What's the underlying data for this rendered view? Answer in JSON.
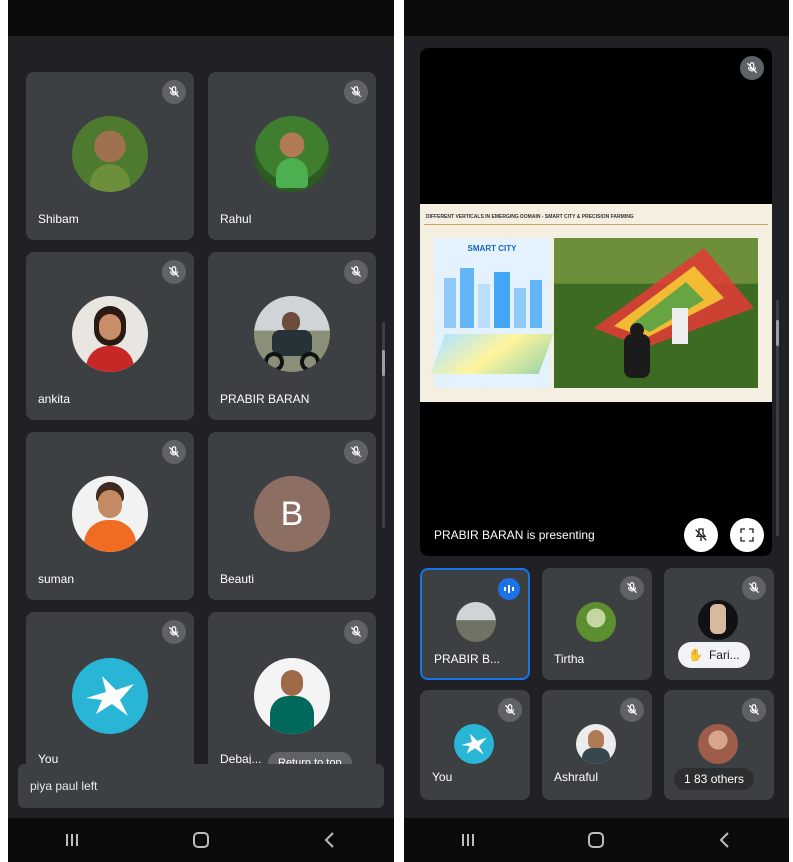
{
  "left": {
    "participants": [
      {
        "name": "Shibam",
        "avatar": "photo"
      },
      {
        "name": "Rahul",
        "avatar": "photo"
      },
      {
        "name": "ankita",
        "avatar": "photo"
      },
      {
        "name": "PRABIR BARAN",
        "avatar": "photo"
      },
      {
        "name": "suman",
        "avatar": "photo"
      },
      {
        "name": "Beauti",
        "avatar": "letter",
        "initial": "B",
        "color": "#8d6e63"
      },
      {
        "name": "You",
        "avatar": "dove-logo"
      },
      {
        "name": "Debaj...",
        "avatar": "photo"
      }
    ],
    "return_pill": "Return to top",
    "toast": "piya paul left"
  },
  "right": {
    "slide_header": "DIFFERENT VERTICALS IN EMERGING DOMAIN - SMART CITY & PRECISION FARMING",
    "slide_panel_label": "SMART CITY",
    "presenting_text": "PRABIR BARAN is presenting",
    "tiles": [
      {
        "name": "PRABIR B...",
        "active": true
      },
      {
        "name": "Tirtha",
        "active": false
      },
      {
        "name": "",
        "pill": "Fari...",
        "active": false
      },
      {
        "name": "You",
        "active": false
      },
      {
        "name": "Ashraful",
        "active": false
      },
      {
        "name": "",
        "others": "1 83 others",
        "active": false
      }
    ]
  },
  "colors": {
    "tile": "#3c4043",
    "background": "#202124",
    "active_border": "#1a73e8",
    "mute_badge": "#5f6368"
  }
}
